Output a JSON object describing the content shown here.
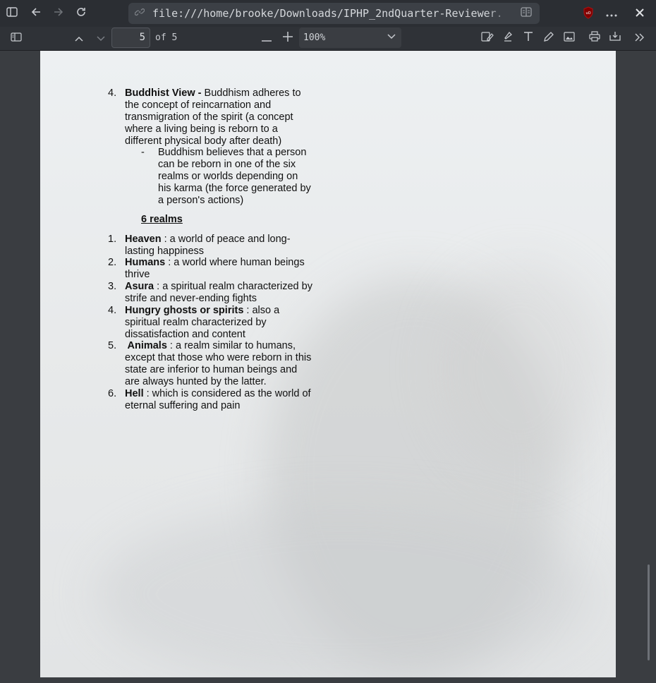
{
  "browser": {
    "url": "file:///home/brooke/Downloads/IPHP_2ndQuarter-Reviewer.",
    "icons": [
      "sidebar-icon",
      "back-icon",
      "forward-icon",
      "reload-icon",
      "link-icon",
      "reader-mode-icon",
      "ublock-icon",
      "more-icon",
      "close-icon"
    ]
  },
  "toolbar": {
    "page_number": "5",
    "page_total": "of 5",
    "zoom": "100%",
    "minus": "—",
    "plus": "+"
  },
  "document": {
    "item4": {
      "number": "4.",
      "title": "Buddhist View -",
      "text": " Buddhism adheres to the concept of reincarnation and transmigration of the spirit (a concept where a living being is reborn to a different physical body after death)"
    },
    "sub_bullet": {
      "dash": "-",
      "text": "Buddhism believes that a person can be reborn in one of the six realms or worlds depending on his karma (the force generated by a person's actions)"
    },
    "realms_heading": "6 realms",
    "realms": [
      {
        "number": "1.",
        "name": "Heaven",
        "desc": " : a world of peace and long-lasting happiness"
      },
      {
        "number": "2.",
        "name": "Humans",
        "desc": " : a world where human beings thrive"
      },
      {
        "number": "3.",
        "name": "Asura",
        "desc": " : a spiritual realm characterized by strife and never-ending fights"
      },
      {
        "number": "4.",
        "name": "Hungry ghosts or spirits",
        "desc": " : also a spiritual realm characterized by dissatisfaction and content"
      },
      {
        "number": "5.",
        "name": " Animals",
        "desc": " : a realm similar to humans, except that those who were reborn in this state are inferior to human beings and are always hunted by the latter."
      },
      {
        "number": "6.",
        "name": "Hell",
        "desc": " : which is considered as the world of eternal suffering and pain"
      }
    ]
  }
}
